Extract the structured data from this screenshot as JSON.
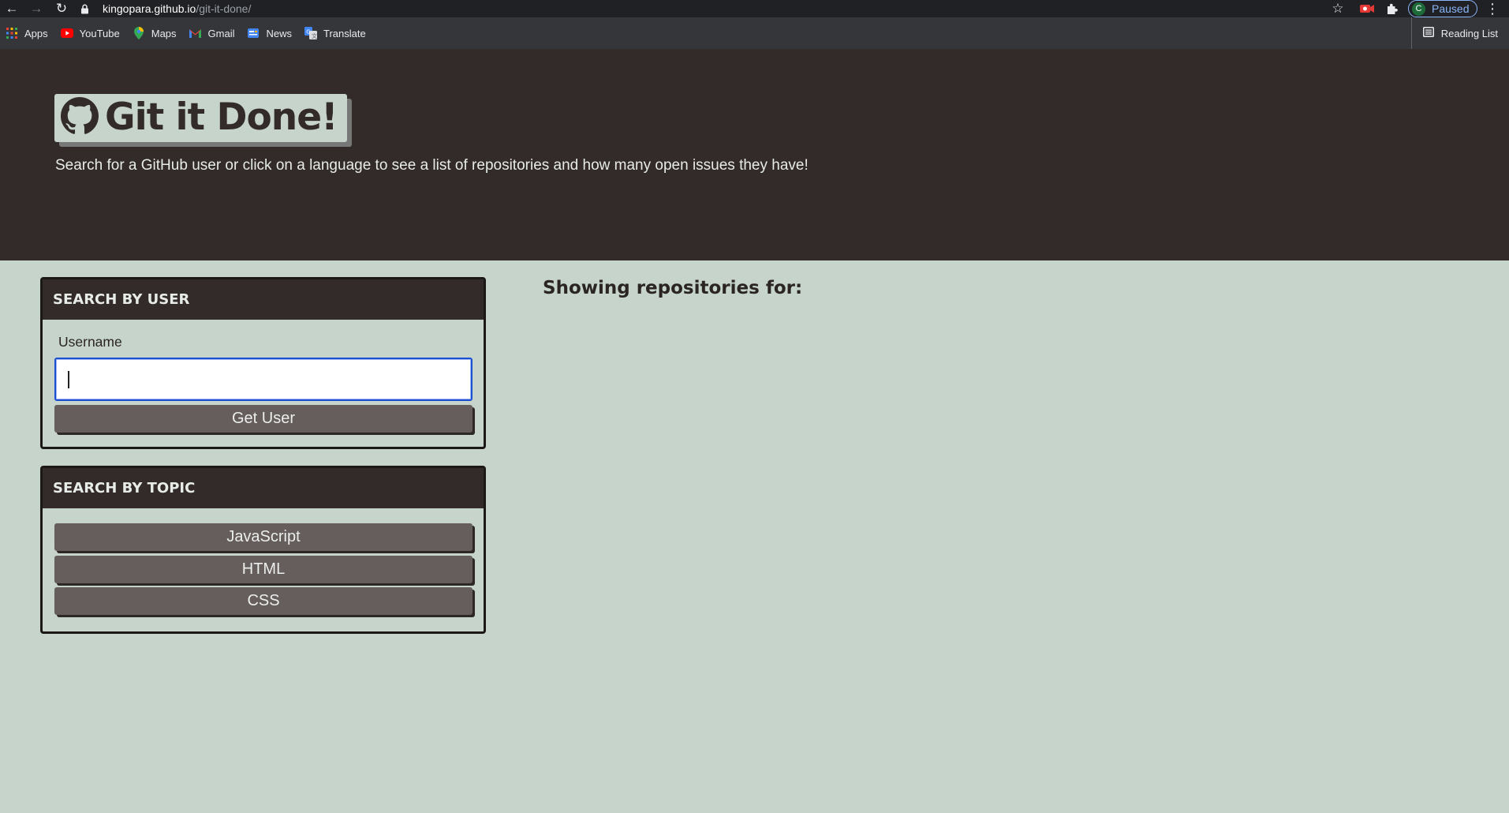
{
  "browser": {
    "url_host": "kingopara.github.io",
    "url_path": "/git-it-done/",
    "profile_initial": "C",
    "profile_status": "Paused",
    "bookmarks": [
      {
        "label": "Apps",
        "icon": "apps-grid-icon"
      },
      {
        "label": "YouTube",
        "icon": "youtube-icon"
      },
      {
        "label": "Maps",
        "icon": "maps-pin-icon"
      },
      {
        "label": "Gmail",
        "icon": "gmail-icon"
      },
      {
        "label": "News",
        "icon": "news-icon"
      },
      {
        "label": "Translate",
        "icon": "translate-icon"
      }
    ],
    "reading_list": "Reading List"
  },
  "hero": {
    "title": "Git it Done!",
    "subtitle": "Search for a GitHub user or click on a language to see a list of repositories and how many open issues they have!"
  },
  "user_search": {
    "heading": "SEARCH BY USER",
    "label": "Username",
    "input_value": "",
    "button": "Get User"
  },
  "topic_search": {
    "heading": "SEARCH BY TOPIC",
    "topics": [
      "JavaScript",
      "HTML",
      "CSS"
    ]
  },
  "repos": {
    "heading": "Showing repositories for:"
  },
  "colors": {
    "page_bg": "#c6d4cb",
    "dark": "#322b29",
    "button": "#655e5c",
    "focus": "#1a4fd1"
  }
}
